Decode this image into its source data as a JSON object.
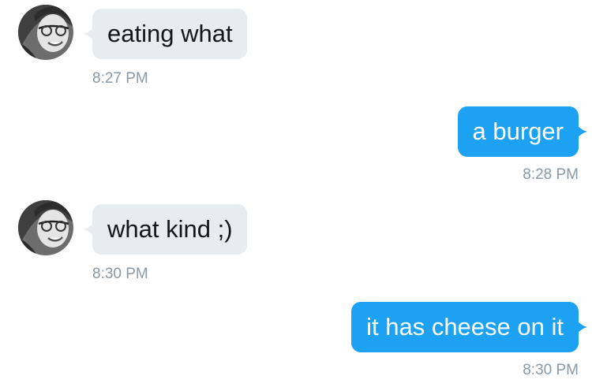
{
  "conversation": {
    "messages": [
      {
        "direction": "incoming",
        "text": "eating what",
        "time": "8:27 PM"
      },
      {
        "direction": "outgoing",
        "text": "a burger",
        "time": "8:28 PM"
      },
      {
        "direction": "incoming",
        "text": "what kind ;)",
        "time": "8:30 PM"
      },
      {
        "direction": "outgoing",
        "text": "it has cheese on it",
        "time": "8:30 PM"
      }
    ]
  },
  "colors": {
    "incoming_bubble": "#e6ecf0",
    "outgoing_bubble": "#1da1f2",
    "timestamp": "#8899a6"
  },
  "icons": {
    "avatar": "user-avatar-grayscale-photo"
  }
}
